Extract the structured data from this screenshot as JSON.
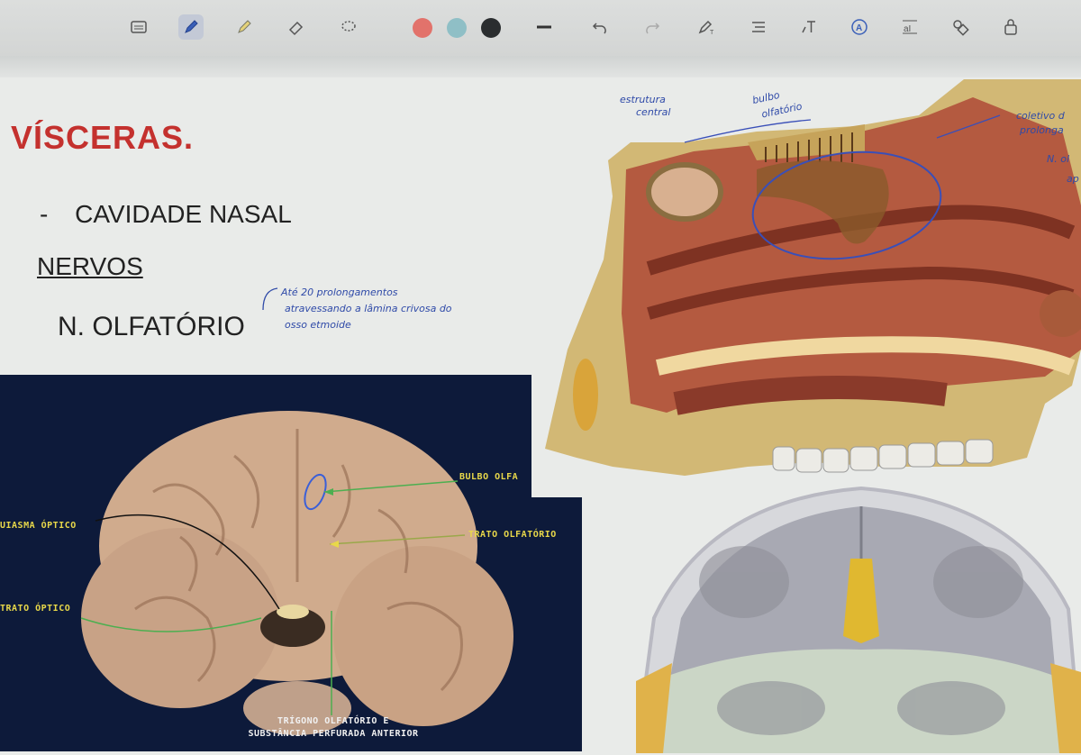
{
  "toolbar": {
    "tools": [
      "keyboard-icon",
      "pen-icon",
      "highlighter-icon",
      "eraser-icon",
      "lasso-icon"
    ],
    "colors": [
      "#e2726b",
      "#8fbfc6",
      "#2a2d2f"
    ],
    "actions": [
      "line-width-icon",
      "undo-icon",
      "redo-icon",
      "pen-text-icon",
      "align-icon",
      "text-tool-icon",
      "text-circle-icon",
      "text-box-icon",
      "shapes-icon",
      "lock-icon"
    ]
  },
  "slide": {
    "title": "VÍSCERAS.",
    "bullet_dash": "-",
    "bullet_text": "CAVIDADE NASAL",
    "section": "NERVOS",
    "nerve": "N. OLFATÓRIO",
    "note_line1": "Até 20 prolongamentos",
    "note_line2": "atravessando a lâmina crivosa do",
    "note_line3": "osso etmoide",
    "annot_struct1": "estrutura",
    "annot_struct2": "central",
    "annot_bulbo1": "bulbo",
    "annot_bulbo2": "olfatório",
    "annot_right1": "coletivo d",
    "annot_right2": "prolonga",
    "annot_right3": "N. ol",
    "annot_right4": "ap"
  },
  "brain": {
    "label_bulbo": "BULBO OLFA",
    "label_trato_olf": "TRATO OLFATÓRIO",
    "label_quiasma": "UIASMA ÓPTICO",
    "label_trato_opt": "TRATO ÓPTICO",
    "caption1": "TRÍGONO OLFATÓRIO E",
    "caption2": "SUBSTÂNCIA PERFURADA ANTERIOR"
  },
  "colors": {
    "title": "#c4312e",
    "annotation": "#2f4aa8",
    "label": "#e8d84a"
  }
}
